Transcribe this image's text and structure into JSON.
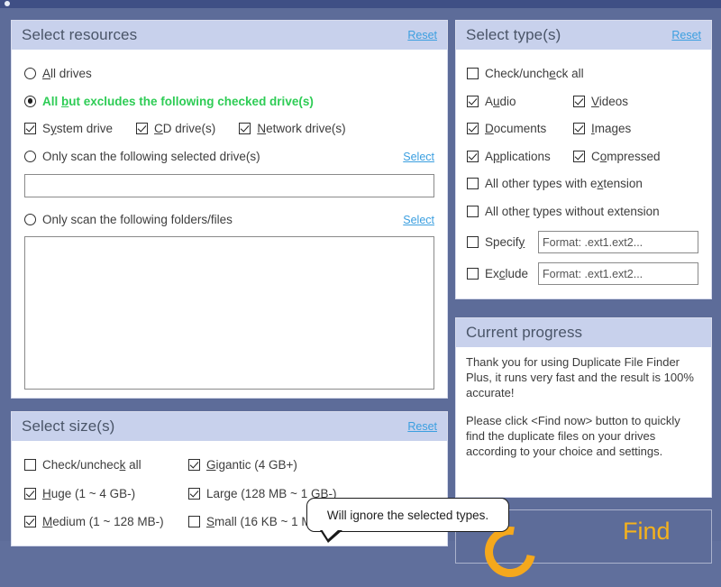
{
  "app": {
    "name": "Duplicate File Finder Plus",
    "accent_blue": "#3b9fe0",
    "accent_green": "#2ecc55",
    "accent_orange": "#f5b21c",
    "panel_header_bg": "#c8d1ec",
    "window_bg": "#5d6c99",
    "titlebar_bg": "#3f4f85"
  },
  "resources_panel": {
    "title": "Select resources",
    "reset_label": "Reset",
    "options": [
      {
        "id": "all-drives",
        "label": "All drives",
        "type": "radio",
        "checked": false,
        "accel": "A"
      },
      {
        "id": "all-but-excludes",
        "label": "All but excludes the following checked drive(s)",
        "type": "radio",
        "checked": true,
        "accel": "b",
        "green": true
      },
      {
        "id": "only-selected-drives",
        "label": "Only scan the following selected drive(s)",
        "type": "radio",
        "checked": false,
        "link": "Select"
      },
      {
        "id": "only-folders-files",
        "label": "Only scan the following folders/files",
        "type": "radio",
        "checked": false,
        "link": "Select"
      }
    ],
    "drive_checkboxes": [
      {
        "id": "system-drive",
        "label": "System drive",
        "checked": true,
        "accel": "y"
      },
      {
        "id": "cd-drives",
        "label": "CD drive(s)",
        "checked": true,
        "accel": "C"
      },
      {
        "id": "network-drives",
        "label": "Network drive(s)",
        "checked": true,
        "accel": "N"
      }
    ],
    "drives_input_value": "",
    "folders_input_value": ""
  },
  "types_panel": {
    "title": "Select type(s)",
    "reset_label": "Reset",
    "check_all": {
      "label": "Check/uncheck all",
      "checked": false
    },
    "types": [
      {
        "label": "Audio",
        "checked": true
      },
      {
        "label": "Videos",
        "checked": true
      },
      {
        "label": "Documents",
        "checked": true
      },
      {
        "label": "Images",
        "checked": true
      },
      {
        "label": "Applications",
        "checked": true
      },
      {
        "label": "Compressed",
        "checked": true
      }
    ],
    "other_with_ext": {
      "label": "All other types with extension",
      "checked": false
    },
    "other_without_ext": {
      "label": "All other types without extension",
      "checked": false
    },
    "specify": {
      "label": "Specify",
      "checked": false,
      "value": "",
      "placeholder": "Format: .ext1.ext2..."
    },
    "exclude": {
      "label": "Exclude",
      "checked": false,
      "value": "",
      "placeholder": "Format: .ext1.ext2..."
    }
  },
  "progress_panel": {
    "title": "Current progress",
    "paragraph_1": "Thank you for using Duplicate File Finder Plus, it runs very fast and the result is 100% accurate!",
    "paragraph_2": "Please click <Find now> button to quickly find the duplicate files on your drives according to your choice and settings."
  },
  "sizes_panel": {
    "title": "Select size(s)",
    "reset_label": "Reset",
    "items": [
      {
        "label": "Check/uncheck all",
        "checked": false,
        "accel": "k"
      },
      {
        "label": "Gigantic (4 GB+)",
        "checked": true,
        "accel": "G"
      },
      {
        "label": "Huge (1 ~ 4 GB-)",
        "checked": true,
        "accel": "H"
      },
      {
        "label": "Large (128 MB ~ 1 GB-)",
        "checked": true,
        "accel": "g"
      },
      {
        "label": "Medium (1 ~ 128 MB-)",
        "checked": true,
        "accel": "M"
      },
      {
        "label": "Small (16 KB ~ 1 M",
        "checked": false,
        "accel": "S"
      }
    ]
  },
  "tooltip": {
    "text": "Will ignore the selected types."
  },
  "find_button": {
    "label": "Find",
    "icon": "refresh-ring-icon"
  }
}
